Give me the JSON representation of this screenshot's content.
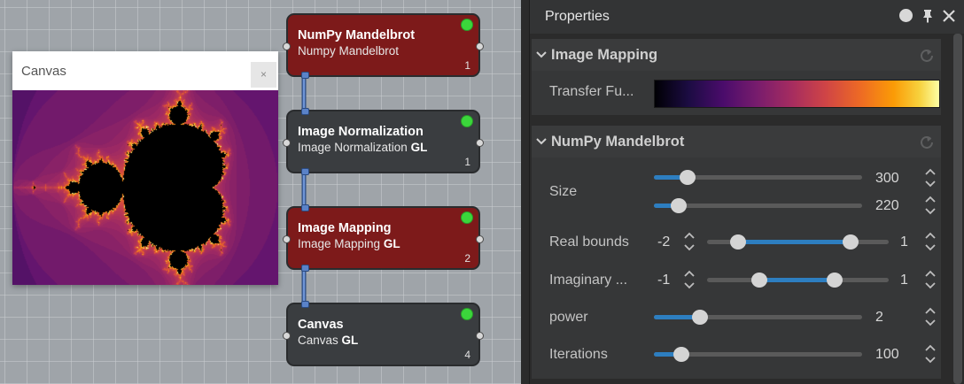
{
  "canvas_window": {
    "title": "Canvas",
    "close_glyph": "×"
  },
  "nodes": [
    {
      "title": "NumPy Mandelbrot",
      "subtitle": "Numpy Mandelbrot",
      "subtitle_bold": "",
      "number": "1",
      "color": "#7d1a1a",
      "status_color": "#3bd63b"
    },
    {
      "title": "Image Normalization",
      "subtitle": "Image Normalization",
      "subtitle_bold": "GL",
      "number": "1",
      "color": "#3a3d40",
      "status_color": "#3bd63b"
    },
    {
      "title": "Image Mapping",
      "subtitle": "Image Mapping",
      "subtitle_bold": "GL",
      "number": "2",
      "color": "#7d1a1a",
      "status_color": "#3bd63b"
    },
    {
      "title": "Canvas",
      "subtitle": "Canvas",
      "subtitle_bold": "GL",
      "number": "4",
      "color": "#3a3d40",
      "status_color": "#3bd63b"
    }
  ],
  "properties": {
    "title": "Properties",
    "header_icons": [
      "circle-icon",
      "pin-icon",
      "close-icon"
    ],
    "sections": {
      "image_mapping": {
        "title": "Image Mapping",
        "transfer_label": "Transfer Fu...",
        "colormap": "inferno"
      },
      "mandelbrot": {
        "title": "NumPy Mandelbrot",
        "size": {
          "label": "Size",
          "width": {
            "value": "300",
            "fraction": 0.16
          },
          "height": {
            "value": "220",
            "fraction": 0.12
          }
        },
        "real_bounds": {
          "label": "Real bounds",
          "min": "-2",
          "max": "1",
          "range": [
            0.17,
            0.79
          ]
        },
        "imaginary_bounds": {
          "label": "Imaginary ...",
          "min": "-1",
          "max": "1",
          "range": [
            0.29,
            0.7
          ]
        },
        "power": {
          "label": "power",
          "value": "2",
          "fraction": 0.22
        },
        "iterations": {
          "label": "Iterations",
          "value": "100",
          "fraction": 0.13
        }
      }
    }
  },
  "colors": {
    "accent": "#2d7ec0",
    "panel_bg": "#2b2b2b",
    "section_header": "#3a3b3c",
    "status_green": "#3bd63b"
  }
}
